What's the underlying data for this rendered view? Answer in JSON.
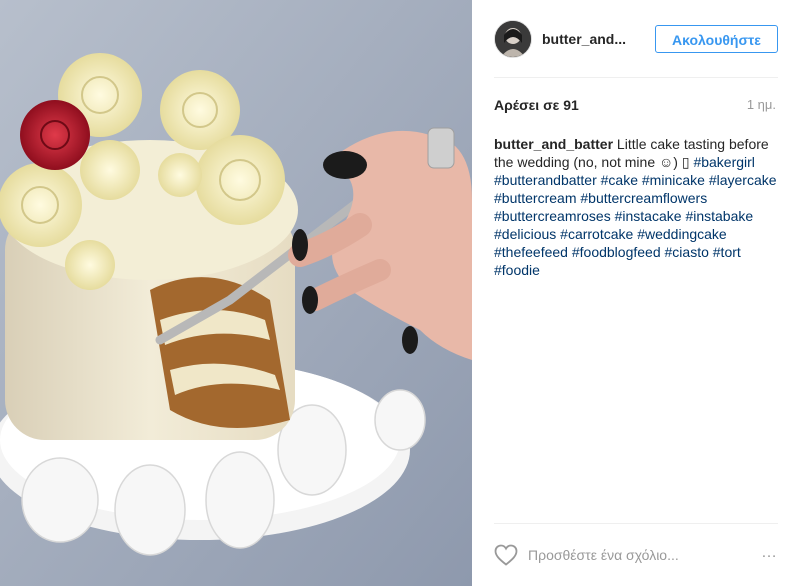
{
  "post": {
    "username": "butter_and...",
    "follow_label": "Ακολουθήστε",
    "likes": "Αρέσει σε 91",
    "time": "1 ημ."
  },
  "caption": {
    "user": "butter_and_batter",
    "text": "Little cake tasting before the wedding (no, not mine ☺) ▯",
    "hashtags": [
      "#bakergirl",
      "#butterandbatter",
      "#cake",
      "#minicake",
      "#layercake",
      "#buttercream",
      "#buttercreamflowers",
      "#buttercreamroses",
      "#instacake",
      "#instabake",
      "#delicious",
      "#carrotcake",
      "#weddingcake",
      "#thefeefeed",
      "#foodblogfeed",
      "#ciasto",
      "#tort",
      "#foodie"
    ]
  },
  "comment": {
    "placeholder": "Προσθέστε ένα σχόλιο...",
    "more_icon": "…"
  },
  "icons": {
    "like": "heart-outline-icon",
    "more": "ellipsis-icon"
  },
  "colors": {
    "accent": "#3897f0",
    "hashtag": "#003569",
    "muted": "#999999"
  }
}
